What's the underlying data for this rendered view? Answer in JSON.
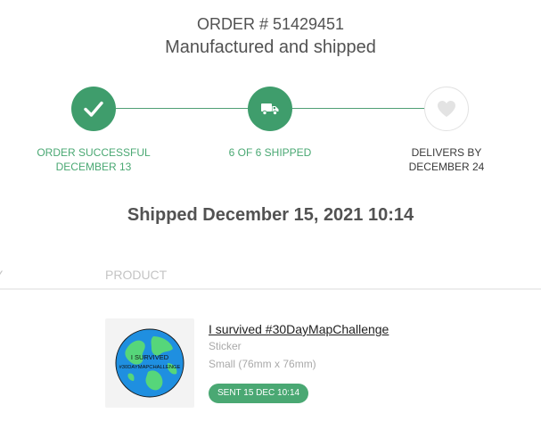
{
  "header": {
    "order_number": "ORDER # 51429451",
    "status": "Manufactured and shipped"
  },
  "progress": {
    "steps": [
      {
        "line1": "ORDER SUCCESSFUL",
        "line2": "DECEMBER 13",
        "state": "done",
        "icon": "checkmark-icon"
      },
      {
        "line1": "6 OF 6 SHIPPED",
        "line2": "",
        "state": "done",
        "icon": "truck-icon"
      },
      {
        "line1": "DELIVERS BY",
        "line2": "DECEMBER 24",
        "state": "pending",
        "icon": "heart-icon"
      }
    ]
  },
  "shipment": {
    "heading": "Shipped December 15, 2021 10:14"
  },
  "table": {
    "columns": {
      "qty": "Y",
      "product": "PRODUCT"
    }
  },
  "item": {
    "name": "I survived #30DayMapChallenge",
    "type": "Sticker",
    "size": "Small (76mm x 76mm)",
    "badge": "SENT 15 DEC 10:14",
    "sticker_text_line1": "I SURVIVED",
    "sticker_text_line2": "#30DAYMAPCHALLENGE"
  },
  "colors": {
    "accent_green": "#4aa873",
    "done_circle": "#3f9d6c",
    "text_dark": "#525252"
  }
}
